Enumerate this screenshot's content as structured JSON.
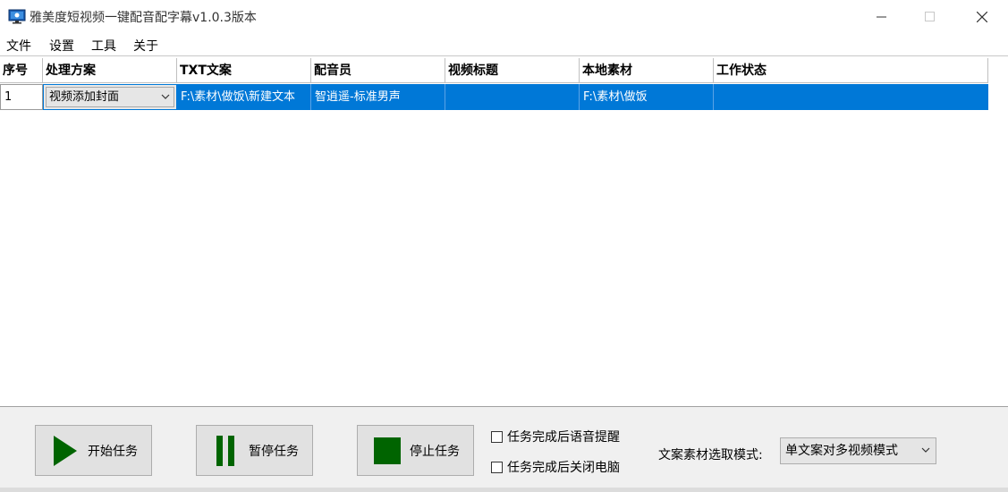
{
  "window": {
    "title": "雅美度短视频一键配音配字幕v1.0.3版本",
    "controls": {
      "minimize": "—",
      "maximize": "☐",
      "close": "✕"
    }
  },
  "menu": {
    "items": [
      "文件",
      "设置",
      "工具",
      "关于"
    ]
  },
  "table": {
    "columns": [
      "序号",
      "处理方案",
      "TXT文案",
      "配音员",
      "视频标题",
      "本地素材",
      "工作状态"
    ],
    "rows": [
      {
        "index": "1",
        "scheme": "视频添加封面",
        "txt": "F:\\素材\\做饭\\新建文本",
        "voice": "智逍遥-标准男声",
        "video_title": "",
        "local_material": "F:\\素材\\做饭",
        "status": ""
      }
    ],
    "selection_color": "#0078d7"
  },
  "controls": {
    "start_label": "开始任务",
    "pause_label": "暂停任务",
    "stop_label": "停止任务",
    "icon_color": "#006400",
    "voice_notify_label": "任务完成后语音提醒",
    "voice_notify_checked": false,
    "shutdown_label": "任务完成后关闭电脑",
    "shutdown_checked": false,
    "mode_label": "文案素材选取模式:",
    "mode_value": "单文案对多视频模式"
  },
  "icons": [
    "app-monitor-icon",
    "play-icon",
    "pause-icon",
    "stop-icon",
    "chevron-down-icon"
  ]
}
